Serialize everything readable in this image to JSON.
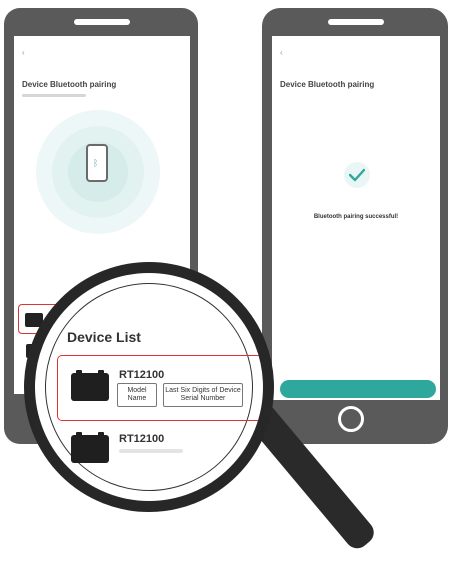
{
  "left_screen": {
    "back_icon": "chevron-left-icon",
    "nav_title": "",
    "heading": "Device Bluetooth pairing",
    "pairing_hint": "",
    "device_list_label": ""
  },
  "right_screen": {
    "back_icon": "chevron-left-icon",
    "nav_title": "",
    "heading": "Device Bluetooth pairing",
    "success_icon": "checkmark-icon",
    "success_title": "Bluetooth pairing successful!",
    "success_sub": "",
    "success_link": "",
    "finish_button": ""
  },
  "magnifier": {
    "title": "Device List",
    "device": {
      "model": "RT12100",
      "model_label": "Model Name",
      "serial_label": "Last Six Digits of Device Serial Number"
    },
    "device_2": {
      "model": "RT12100"
    }
  },
  "colors": {
    "accent": "#2ea89c",
    "highlight": "#dd3333",
    "phone_body": "#5a5a5a"
  }
}
